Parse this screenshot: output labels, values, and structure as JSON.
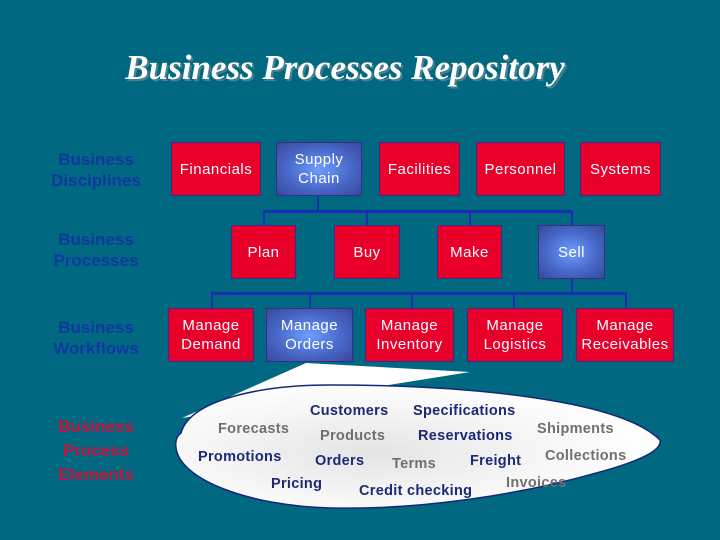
{
  "title": "Business Processes Repository",
  "row_labels": {
    "disciplines": [
      "Business",
      "Disciplines"
    ],
    "processes": [
      "Business",
      "Processes"
    ],
    "workflows": [
      "Business",
      "Workflows"
    ],
    "elements": [
      "Business",
      "Process",
      "Elements"
    ]
  },
  "disciplines": [
    {
      "lines": [
        "Financials"
      ],
      "style": "red"
    },
    {
      "lines": [
        "Supply",
        "Chain"
      ],
      "style": "blue"
    },
    {
      "lines": [
        "Facilities"
      ],
      "style": "red"
    },
    {
      "lines": [
        "Personnel"
      ],
      "style": "red"
    },
    {
      "lines": [
        "Systems"
      ],
      "style": "red"
    }
  ],
  "processes": [
    {
      "lines": [
        "Plan"
      ],
      "style": "red"
    },
    {
      "lines": [
        "Buy"
      ],
      "style": "red"
    },
    {
      "lines": [
        "Make"
      ],
      "style": "red"
    },
    {
      "lines": [
        "Sell"
      ],
      "style": "blue"
    }
  ],
  "workflows": [
    {
      "lines": [
        "Manage",
        "Demand"
      ],
      "style": "red"
    },
    {
      "lines": [
        "Manage",
        "Orders"
      ],
      "style": "blue"
    },
    {
      "lines": [
        "Manage",
        "Inventory"
      ],
      "style": "red"
    },
    {
      "lines": [
        "Manage",
        "Logistics"
      ],
      "style": "red"
    },
    {
      "lines": [
        "Manage",
        "Receivables"
      ],
      "style": "red"
    }
  ],
  "elements": [
    {
      "text": "Customers",
      "tone": "dark"
    },
    {
      "text": "Specifications",
      "tone": "dark"
    },
    {
      "text": "Forecasts",
      "tone": "grey"
    },
    {
      "text": "Products",
      "tone": "grey"
    },
    {
      "text": "Reservations",
      "tone": "dark"
    },
    {
      "text": "Shipments",
      "tone": "grey"
    },
    {
      "text": "Promotions",
      "tone": "dark"
    },
    {
      "text": "Orders",
      "tone": "dark"
    },
    {
      "text": "Terms",
      "tone": "grey"
    },
    {
      "text": "Freight",
      "tone": "dark"
    },
    {
      "text": "Collections",
      "tone": "grey"
    },
    {
      "text": "Pricing",
      "tone": "dark"
    },
    {
      "text": "Credit checking",
      "tone": "dark"
    },
    {
      "text": "Invoices",
      "tone": "grey"
    }
  ]
}
